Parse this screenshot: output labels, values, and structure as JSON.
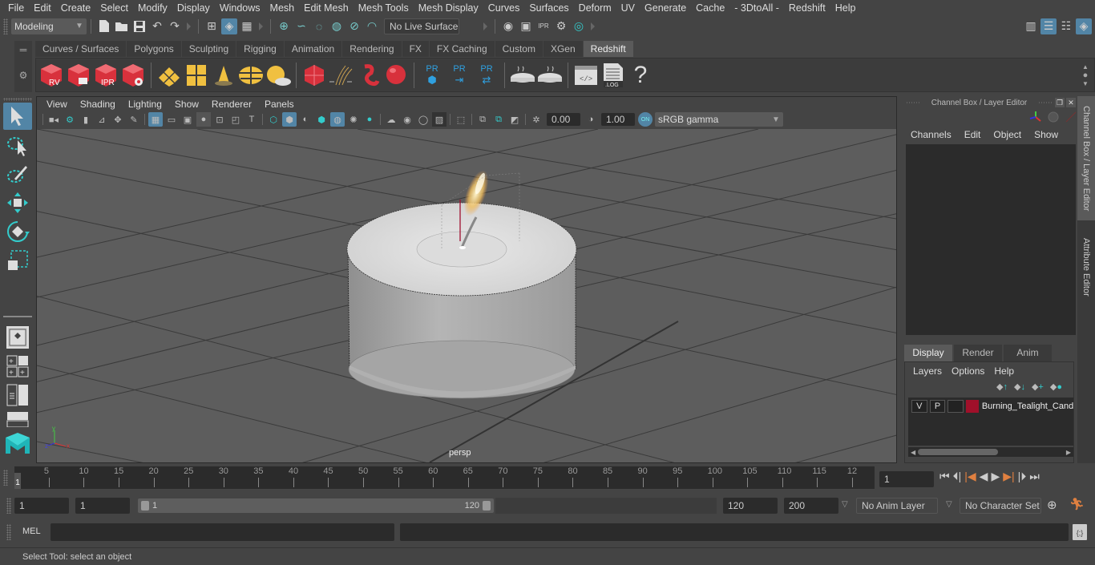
{
  "menubar": {
    "items": [
      "File",
      "Edit",
      "Create",
      "Select",
      "Modify",
      "Display",
      "Windows",
      "Mesh",
      "Edit Mesh",
      "Mesh Tools",
      "Mesh Display",
      "Curves",
      "Surfaces",
      "Deform",
      "UV",
      "Generate",
      "Cache",
      "- 3DtoAll -",
      "Redshift",
      "Help"
    ]
  },
  "statusline": {
    "workspace": "Modeling",
    "live_surface": "No Live Surface"
  },
  "shelf": {
    "tabs": [
      "Curves / Surfaces",
      "Polygons",
      "Sculpting",
      "Rigging",
      "Animation",
      "Rendering",
      "FX",
      "FX Caching",
      "Custom",
      "XGen",
      "Redshift"
    ],
    "active_tab": "Redshift",
    "icons": [
      {
        "name": "rs-render-view-icon",
        "label": "RV"
      },
      {
        "name": "rs-render-sequence-icon",
        "label": ""
      },
      {
        "name": "rs-ipr-icon",
        "label": "IPR"
      },
      {
        "name": "rs-render-settings-icon",
        "label": ""
      },
      {
        "name": "rs-area-light-icon",
        "label": ""
      },
      {
        "name": "rs-portal-light-icon",
        "label": ""
      },
      {
        "name": "rs-spot-light-icon",
        "label": ""
      },
      {
        "name": "rs-dome-light-icon",
        "label": ""
      },
      {
        "name": "rs-sun-sky-icon",
        "label": ""
      },
      {
        "name": "rs-proxy-icon",
        "label": ""
      },
      {
        "name": "rs-hair-icon",
        "label": ""
      },
      {
        "name": "rs-volume-icon",
        "label": ""
      },
      {
        "name": "rs-material-icon",
        "label": ""
      },
      {
        "name": "pr-proxy-icon",
        "label": "PR"
      },
      {
        "name": "pr-export-icon",
        "label": "PR"
      },
      {
        "name": "pr-convert-icon",
        "label": "PR"
      },
      {
        "name": "baking-icon",
        "label": ""
      },
      {
        "name": "baking-2-icon",
        "label": ""
      },
      {
        "name": "script-editor-icon",
        "label": ""
      },
      {
        "name": "log-icon",
        "label": ".LOG"
      },
      {
        "name": "help-icon",
        "label": "?"
      }
    ]
  },
  "viewport": {
    "menu": [
      "View",
      "Shading",
      "Lighting",
      "Show",
      "Renderer",
      "Panels"
    ],
    "exposure": "0.00",
    "gamma": "1.00",
    "color_space_toggle": "ON",
    "color_space": "sRGB gamma",
    "camera_label": "persp",
    "axis_labels": {
      "x": "x",
      "y": "y",
      "z": "z"
    }
  },
  "channel_box": {
    "title": "Channel Box / Layer Editor",
    "menu": [
      "Channels",
      "Edit",
      "Object",
      "Show"
    ]
  },
  "side_tabs": [
    "Channel Box / Layer Editor",
    "Attribute Editor"
  ],
  "layer_editor": {
    "tabs": [
      "Display",
      "Render",
      "Anim"
    ],
    "active_tab": "Display",
    "menu": [
      "Layers",
      "Options",
      "Help"
    ],
    "layers": [
      {
        "visible": "V",
        "playback": "P",
        "type": "",
        "color": "#a0102a",
        "name": "Burning_Tealight_Candle"
      }
    ]
  },
  "timeline": {
    "ticks": [
      5,
      10,
      15,
      20,
      25,
      30,
      35,
      40,
      45,
      50,
      55,
      60,
      65,
      70,
      75,
      80,
      85,
      90,
      95,
      100,
      105,
      110,
      115,
      "12"
    ],
    "current_marker": "1",
    "current_frame": "1"
  },
  "range": {
    "start": "1",
    "playback_start": "1",
    "slider_start": "1",
    "slider_end": "120",
    "playback_end": "120",
    "end": "200",
    "anim_layer": "No Anim Layer",
    "character_set": "No Character Set"
  },
  "command": {
    "language": "MEL"
  },
  "help_line": "Select Tool: select an object"
}
